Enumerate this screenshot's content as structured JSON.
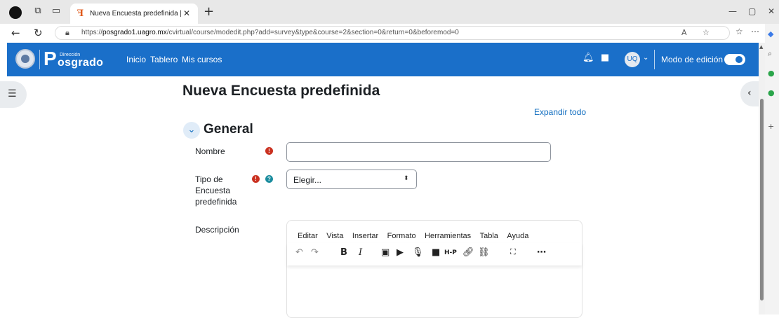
{
  "browser": {
    "tab_title": "Nueva Encuesta predefinida | CC",
    "url_prefix": "https://",
    "url_host": "posgrado1.uagro.mx",
    "url_path": "/cvirtual/course/modedit.php?add=survey&type&course=2&section=0&return=0&beforemod=0"
  },
  "navbar": {
    "logo_small": "Dirección",
    "logo_main": "osgrado",
    "logo_p": "P",
    "links": [
      "Inicio",
      "Tablero",
      "Mis cursos"
    ],
    "avatar": "UQ",
    "edit_mode_label": "Modo de edición"
  },
  "page": {
    "title": "Nueva Encuesta predefinida",
    "expand_all": "Expandir todo",
    "section_title": "General"
  },
  "form": {
    "nombre_label": "Nombre",
    "nombre_value": "",
    "tipo_label_1": "Tipo de",
    "tipo_label_2": "Encuesta",
    "tipo_label_3": "predefinida",
    "tipo_value": "Elegir...",
    "descripcion_label": "Descripción"
  },
  "editor": {
    "menu": [
      "Editar",
      "Vista",
      "Insertar",
      "Formato",
      "Herramientas",
      "Tabla",
      "Ayuda"
    ]
  },
  "colors": {
    "navbar": "#1a6fc9",
    "required": "#ca3120",
    "help": "#1a8c9e",
    "link": "#0f6cbf"
  },
  "icons": [
    "undo-icon",
    "redo-icon",
    "bold-icon",
    "italic-icon",
    "image-icon",
    "media-icon",
    "microphone-icon",
    "video-icon",
    "h5p-icon",
    "link-icon",
    "unlink-icon",
    "fullscreen-icon",
    "more-icon"
  ]
}
